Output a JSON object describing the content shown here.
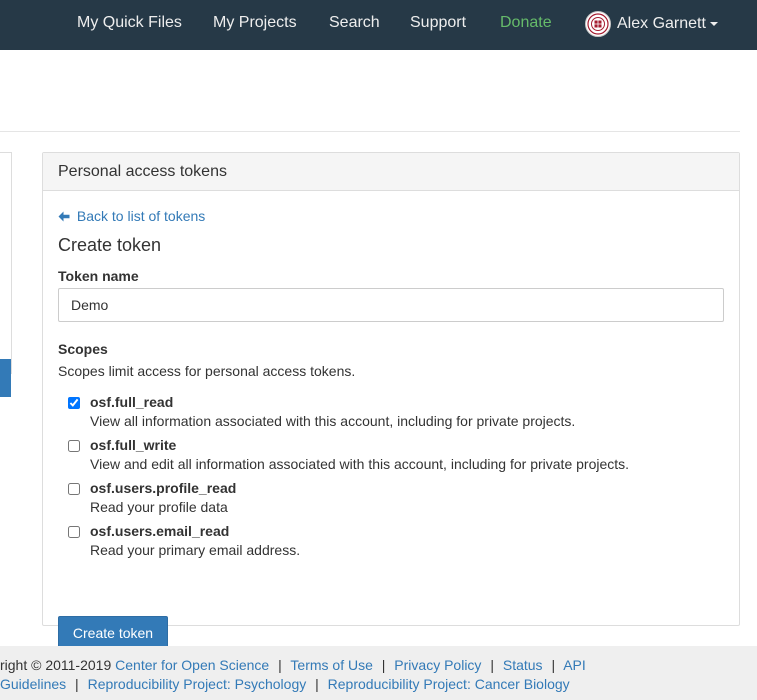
{
  "nav": {
    "quick_files": "My Quick Files",
    "projects": "My Projects",
    "search": "Search",
    "support": "Support",
    "donate": "Donate",
    "user_name": "Alex Garnett",
    "colors": {
      "bar": "#263947",
      "donate": "#66bb6a"
    }
  },
  "panel": {
    "heading": "Personal access tokens",
    "back_link": "Back to list of tokens",
    "title": "Create token",
    "token_name_label": "Token name",
    "token_name_value": "Demo",
    "scopes_label": "Scopes",
    "scopes_help": "Scopes limit access for personal access tokens.",
    "scopes": [
      {
        "name": "osf.full_read",
        "description": "View all information associated with this account, including for private projects.",
        "checked": true
      },
      {
        "name": "osf.full_write",
        "description": "View and edit all information associated with this account, including for private projects.",
        "checked": false
      },
      {
        "name": "osf.users.profile_read",
        "description": "Read your profile data",
        "checked": false
      },
      {
        "name": "osf.users.email_read",
        "description": "Read your primary email address.",
        "checked": false
      }
    ],
    "create_button": "Create token"
  },
  "footer": {
    "copyright": "right © 2011-2019",
    "center": "Center for Open Science",
    "terms": "Terms of Use",
    "privacy": "Privacy Policy",
    "status": "Status",
    "api": "API",
    "guidelines": "Guidelines",
    "rp_psych": "Reproducibility Project: Psychology",
    "rp_cancer": "Reproducibility Project: Cancer Biology",
    "separator": "|"
  },
  "accent_color": "#337ab7"
}
